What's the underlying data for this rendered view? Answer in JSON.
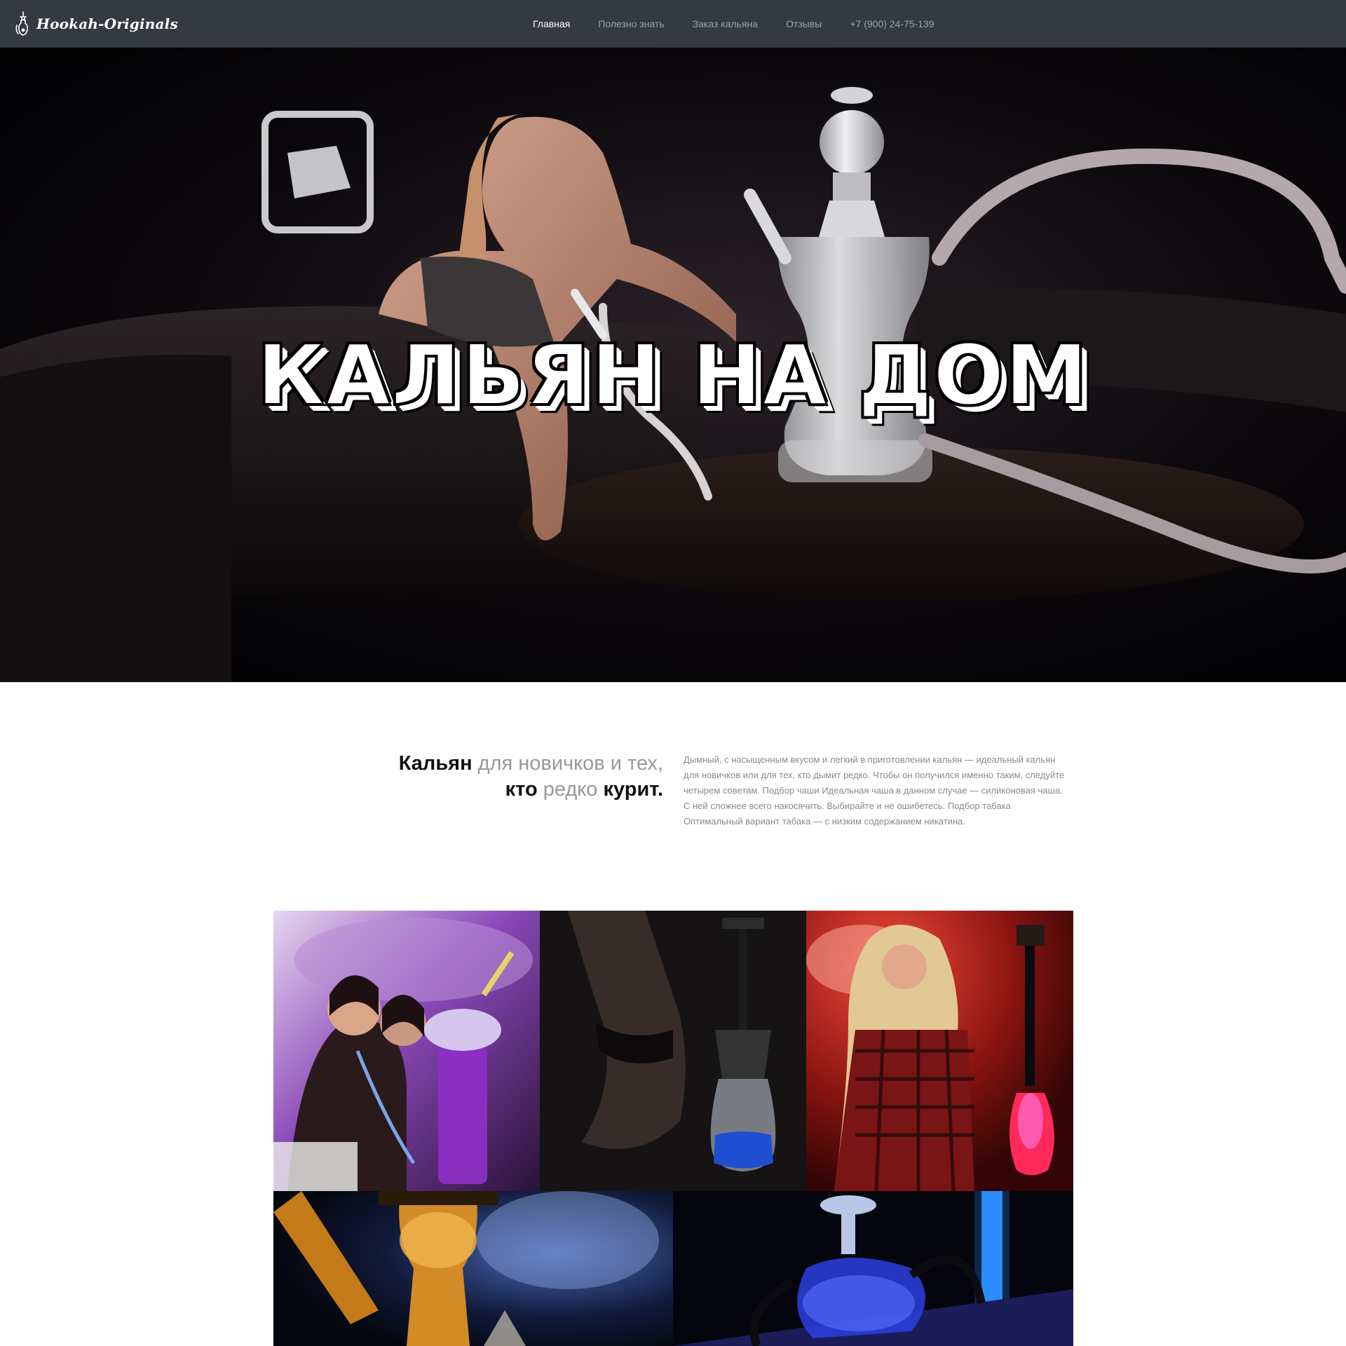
{
  "navbar": {
    "brand": "Hookah-Originals",
    "links": [
      {
        "label": "Главная",
        "active": true
      },
      {
        "label": "Полезно знать",
        "active": false
      },
      {
        "label": "Заказ кальяна",
        "active": false
      },
      {
        "label": "Отзывы",
        "active": false
      },
      {
        "label": "+7 (900) 24-75-139",
        "active": false
      }
    ]
  },
  "hero": {
    "title": "КАЛЬЯН НА ДОМ"
  },
  "intro": {
    "heading_parts": [
      {
        "text": "Кальян",
        "strong": true
      },
      {
        "text": " для новичков и тех, ",
        "strong": false
      },
      {
        "text": "кто",
        "strong": true
      },
      {
        "text": " редко ",
        "strong": false
      },
      {
        "text": "курит.",
        "strong": true
      }
    ],
    "text": "Дымный, с насыщенным вкусом и легкий в приготовлении кальян — идеальный кальян для новичков или для тех, кто дымит редко. Чтобы он получился именно таким, следуйте четырем советам. Подбор чаши Идеальная чаша в данном случае — силиконовая чаша. С ней сложнее всего накосячить. Выбирайте и не ошибетесь. Подбор табака Оптимальный вариант табака — с низким содержанием никатина."
  },
  "colors": {
    "navbar_bg": "#343a40",
    "nav_link": "#9aa0a6",
    "nav_link_active": "#ffffff",
    "heading_muted": "#999999",
    "heading_strong": "#111111",
    "body_text": "#8a8a8a"
  },
  "icons": {
    "brand": "hookah-icon"
  }
}
